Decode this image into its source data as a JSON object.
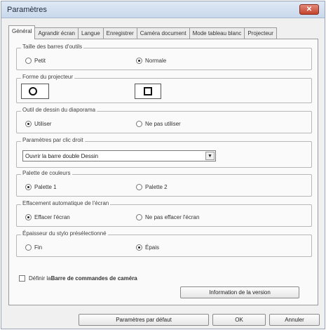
{
  "window": {
    "title": "Paramètres",
    "close_label": "✕"
  },
  "tabs": [
    {
      "label": "Général"
    },
    {
      "label": "Agrandir écran"
    },
    {
      "label": "Langue"
    },
    {
      "label": "Enregistrer"
    },
    {
      "label": "Caméra document"
    },
    {
      "label": "Mode tableau blanc"
    },
    {
      "label": "Projecteur"
    }
  ],
  "groups": {
    "toolbar_size": {
      "legend": "Taille des barres d'outils",
      "options": [
        "Petit",
        "Normale"
      ],
      "selected": "Normale"
    },
    "projector_shape": {
      "legend": "Forme du projecteur"
    },
    "slideshow_tool": {
      "legend": "Outil de dessin du diaporama",
      "options": [
        "Utiliser",
        "Ne pas utiliser"
      ],
      "selected": "Utiliser"
    },
    "right_click": {
      "legend": "Paramètres par clic droit",
      "select_value": "Ouvrir la barre double Dessin"
    },
    "color_palette": {
      "legend": "Palette de couleurs",
      "options": [
        "Palette 1",
        "Palette 2"
      ],
      "selected": "Palette 1"
    },
    "auto_clear": {
      "legend": "Effacement automatique de l'écran",
      "options": [
        "Effacer l'écran",
        "Ne pas effacer l'écran"
      ],
      "selected": "Effacer l'écran"
    },
    "pen_thickness": {
      "legend": "Épaisseur du stylo présélectionné",
      "options": [
        "Fin",
        "Épais"
      ],
      "selected": "Épais"
    }
  },
  "camera_toolbar": {
    "prefix": "Définir la ",
    "bold": "Barre de commandes de caméra",
    "checked": false
  },
  "buttons": {
    "version_info": "Information de la version",
    "defaults": "Paramètres par défaut",
    "ok": "OK",
    "cancel": "Annuler"
  }
}
